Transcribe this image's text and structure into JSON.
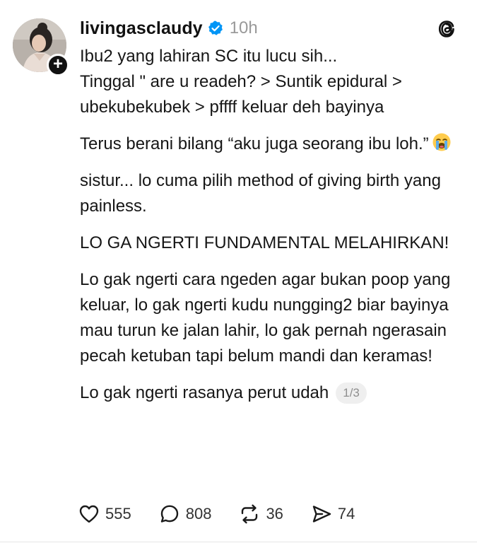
{
  "post": {
    "author": {
      "username": "livingasclaudy",
      "verified": true,
      "avatar_icon": "profile-photo"
    },
    "time": "10h",
    "paragraphs": [
      "Ibu2 yang lahiran SC itu lucu sih...",
      "Tinggal \" are u readeh? > Suntik epidural > ubekubekubek > pffff keluar deh bayinya",
      "Terus berani bilang “aku juga seorang ibu loh.”",
      "sistur... lo cuma pilih method of giving birth yang painless.",
      "LO GA NGERTI FUNDAMENTAL MELAHIRKAN!",
      "Lo gak ngerti cara ngeden agar bukan poop yang keluar, lo gak ngerti kudu nungging2 biar bayinya mau turun ke jalan lahir, lo gak pernah ngerasain pecah ketuban tapi belum mandi dan keramas!",
      "Lo gak ngerti rasanya perut udah"
    ],
    "emoji_after_paragraph_3": "loudly-crying-face",
    "page_indicator": "1/3",
    "actions": {
      "likes": "555",
      "replies": "808",
      "reposts": "36",
      "shares": "74"
    },
    "icons": {
      "like": "heart-icon",
      "reply": "comment-icon",
      "repost": "repost-icon",
      "share": "send-icon",
      "app": "threads-logo-icon",
      "verified": "verified-badge-icon",
      "follow": "plus-icon"
    },
    "colors": {
      "text": "#161616",
      "muted": "#9a9a9a",
      "verified_blue": "#0095f6"
    }
  }
}
